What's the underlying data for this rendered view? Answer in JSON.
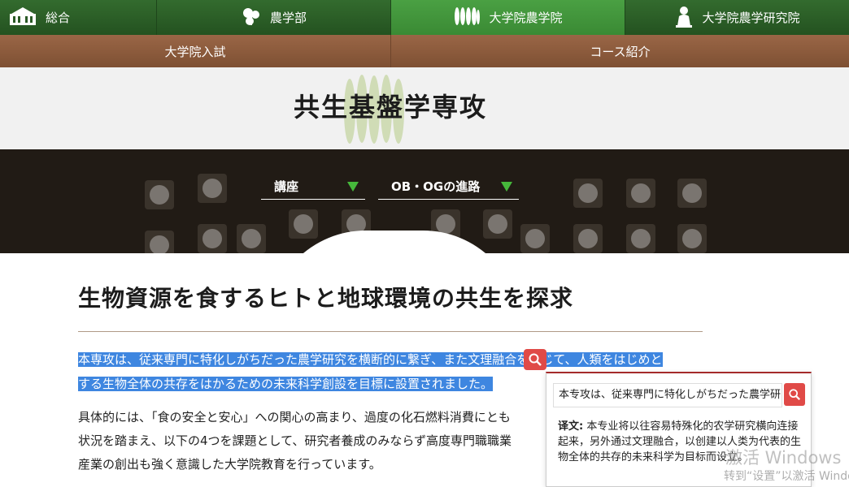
{
  "topnav": {
    "items": [
      {
        "label": "総合",
        "icon": "campus-building-icon"
      },
      {
        "label": "農学部",
        "icon": "leaf-icon"
      },
      {
        "label": "大学院農学院",
        "icon": "grass-icon"
      },
      {
        "label": "大学院農学研究院",
        "icon": "statue-icon"
      }
    ],
    "active": "大学院農学院"
  },
  "subnav": {
    "items": [
      "大学院入試",
      "コース紹介"
    ]
  },
  "title": "共生基盤学専攻",
  "dropdowns": [
    "講座",
    "OB・OGの進路"
  ],
  "heading": "生物資源を食するヒトと地球環境の共生を探求",
  "paragraph1": {
    "line1": "本専攻は、従来専門に特化しがちだった農学研究を横断的に繋ぎ、また文理融合を通じて、人類をはじめと",
    "line2": "する生物全体の共存をはかるための未来科学創設を目標に設置されました。"
  },
  "paragraph2": {
    "line1": "具体的には、「食の安全と安心」への関心の高まり、過度の化石燃料消費にとも",
    "line2": "状況を踏まえ、以下の4つを課題として、研究者養成のみならず高度専門職職業",
    "line3": "産業の創出も強く意識した大学院教育を行っています。"
  },
  "translation": {
    "query": "本专攻は、従来専門に特化しがちだった農学研",
    "label": "译文:",
    "text": "本专业将以往容易特殊化的农学研究横向连接起来，另外通过文理融合，以创建以人类为代表的生物全体的共存的未来科学为目标而设立。"
  },
  "watermark": {
    "title": "激活 Windows",
    "subtitle": "转到“设置”以激活 Windows。"
  },
  "colors": {
    "nav_green": "#2a5a26",
    "nav_active": "#4aa043",
    "subnav_brown": "#8b5a3c",
    "selection_blue": "#3e86e0",
    "search_red": "#e04a47",
    "dropdown_arrow": "#46b83b"
  }
}
